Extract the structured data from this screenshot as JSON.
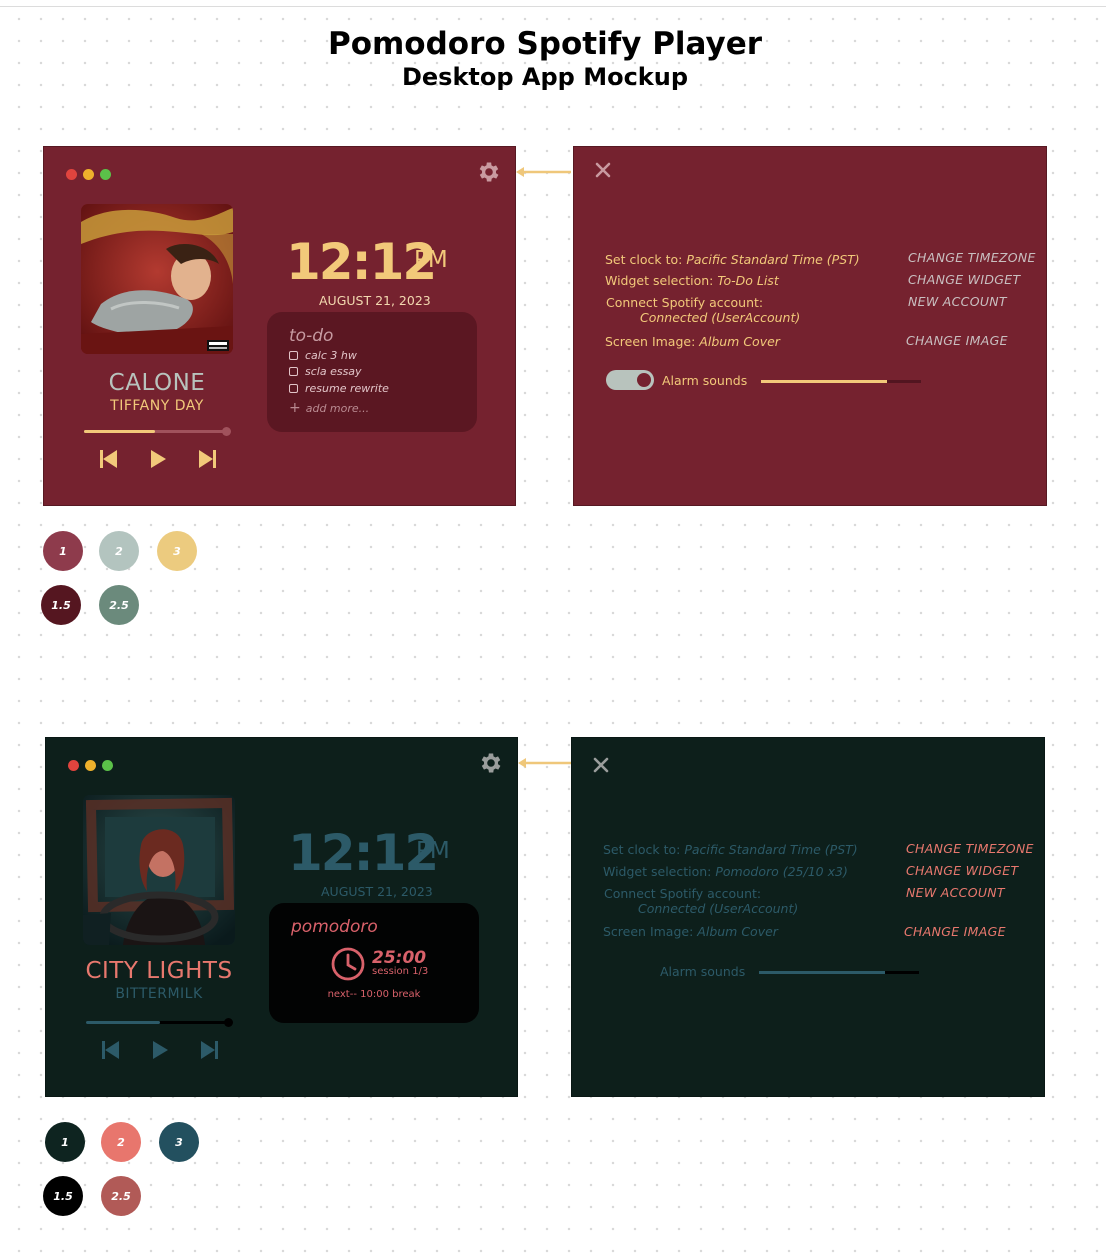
{
  "header": {
    "title": "Pomodoro Spotify Player",
    "subtitle": "Desktop App Mockup"
  },
  "theme_red": {
    "colors": {
      "panel_bg": "#75222f",
      "accent": "#f2c97a",
      "muted": "#b8c3bd",
      "widget_bg": "#5b1722",
      "todo_muted": "#c69aa1"
    },
    "player": {
      "song_title": "CALONE",
      "artist": "TIFFANY DAY",
      "progress_fraction": 0.5,
      "clock_time": "12:12",
      "clock_ampm": "PM",
      "clock_date": "AUGUST 21, 2023",
      "album_parental_advisory": "PARENTAL ADVISORY EXPLICIT CONTENT"
    },
    "todo": {
      "title": "to-do",
      "items": [
        "calc 3 hw",
        "scla essay",
        "resume rewrite"
      ],
      "add_more": "add more..."
    },
    "settings": {
      "clock_label": "Set clock to:",
      "clock_value": "Pacific Standard Time (PST)",
      "widget_label": "Widget selection:",
      "widget_value": "To-Do List",
      "spotify_label": "Connect Spotify account:",
      "spotify_value": "Connected (UserAccount)",
      "image_label": "Screen Image:",
      "image_value": "Album Cover",
      "change_timezone": "CHANGE TIMEZONE",
      "change_widget": "CHANGE WIDGET",
      "new_account": "NEW ACCOUNT",
      "change_image": "CHANGE IMAGE",
      "alarm_label": "Alarm sounds",
      "alarm_on": true,
      "alarm_volume_fraction": 0.79
    },
    "swatches": [
      {
        "label": "1",
        "color": "#8e3b4c"
      },
      {
        "label": "2",
        "color": "#b3c4bf"
      },
      {
        "label": "3",
        "color": "#eccb7f"
      },
      {
        "label": "1.5",
        "color": "#551620"
      },
      {
        "label": "2.5",
        "color": "#6b8a7c"
      }
    ]
  },
  "theme_dark": {
    "colors": {
      "panel_bg": "#0d1f1b",
      "accent": "#e8786e",
      "muted": "#2c5a68",
      "widget_bg": "#020303",
      "pomo_accent": "#d8616a"
    },
    "player": {
      "song_title": "CITY LIGHTS",
      "artist": "BITTERMILK",
      "progress_fraction": 0.52,
      "clock_time": "12:12",
      "clock_ampm": "PM",
      "clock_date": "AUGUST 21, 2023"
    },
    "pomodoro": {
      "title": "pomodoro",
      "timer": "25:00",
      "session": "session 1/3",
      "next": "next-- 10:00 break"
    },
    "settings": {
      "clock_label": "Set clock to:",
      "clock_value": "Pacific Standard Time (PST)",
      "widget_label": "Widget selection:",
      "widget_value": "Pomodoro (25/10 x3)",
      "spotify_label": "Connect Spotify account:",
      "spotify_value": "Connected (UserAccount)",
      "image_label": "Screen Image:",
      "image_value": "Album Cover",
      "change_timezone": "CHANGE TIMEZONE",
      "change_widget": "CHANGE WIDGET",
      "new_account": "NEW ACCOUNT",
      "change_image": "CHANGE IMAGE",
      "alarm_label": "Alarm sounds",
      "alarm_volume_fraction": 0.79
    },
    "swatches": [
      {
        "label": "1",
        "color": "#0e2420"
      },
      {
        "label": "2",
        "color": "#e8766d"
      },
      {
        "label": "3",
        "color": "#23505f"
      },
      {
        "label": "1.5",
        "color": "#000000"
      },
      {
        "label": "2.5",
        "color": "#b15a57"
      }
    ]
  }
}
